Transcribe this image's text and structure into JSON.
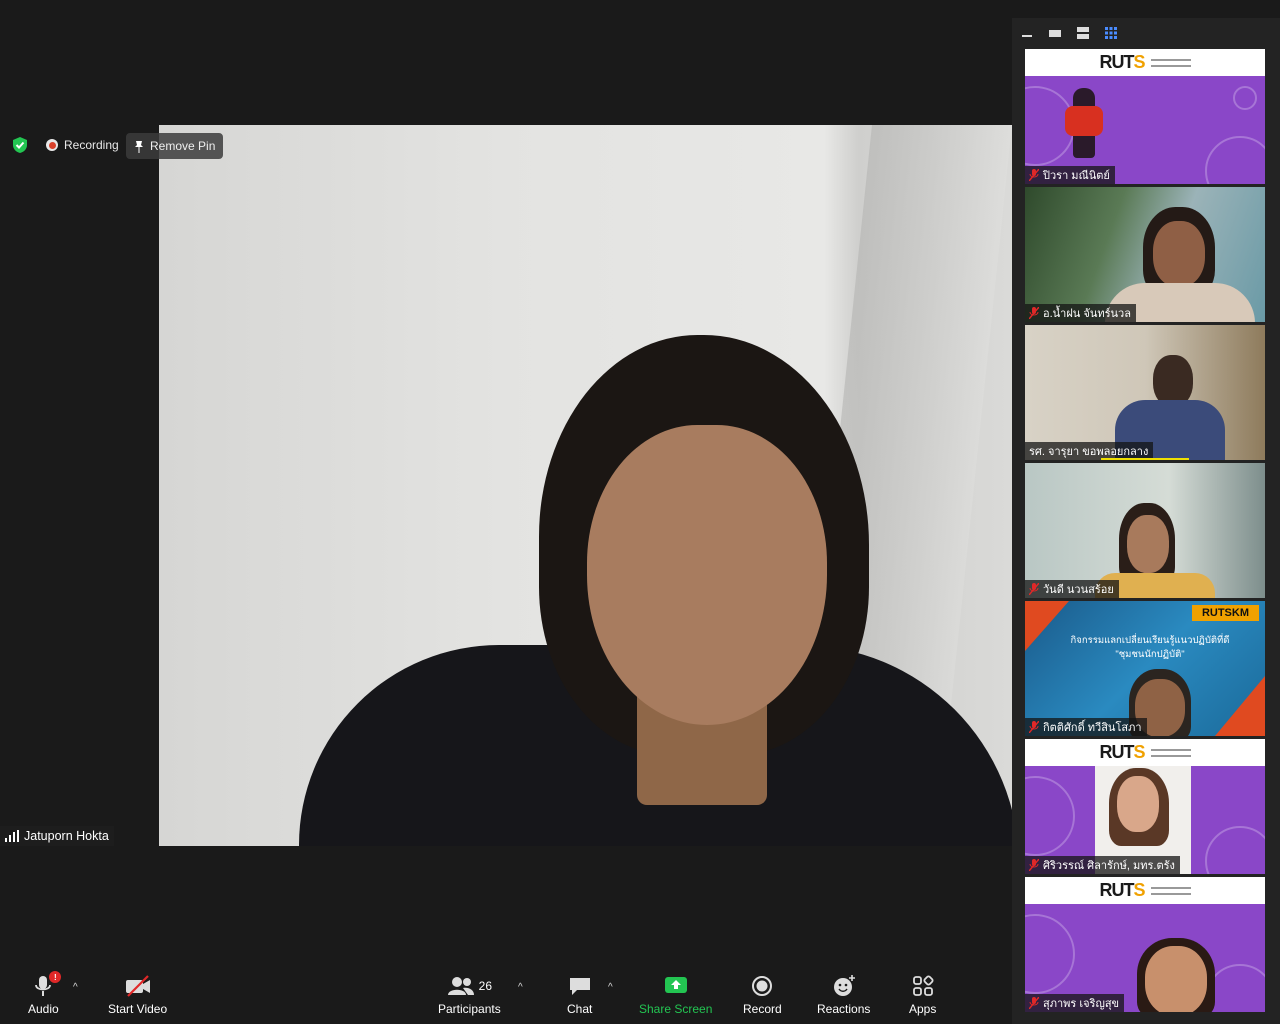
{
  "status": {
    "recording_label": "Recording",
    "remove_pin_label": "Remove Pin"
  },
  "main": {
    "speaker_name": "Jatuporn Hokta"
  },
  "gallery": {
    "tiles": [
      {
        "name": "ปิวรา มณีนิตย์",
        "background": "rut-banner"
      },
      {
        "name": "อ.น้ำฝน จันทร์นวล",
        "background": "video"
      },
      {
        "name": "รศ. จารุยา ขอพลอยกลาง",
        "background": "video"
      },
      {
        "name": "วันดี นวนสร้อย",
        "background": "video"
      },
      {
        "name": "กิตติศักดิ์ ทวีสินโสภา",
        "background": "rutskm-banner"
      },
      {
        "name": "ศิริวรรณ์ ศิลารักษ์, มทร.ตรัง",
        "background": "rut-banner"
      },
      {
        "name": "สุภาพร เจริญสุข",
        "background": "rut-banner"
      }
    ],
    "rut_logo": "RUTS",
    "rutskm_title": "RUTSKM",
    "rutskm_line1": "กิจกรรมแลกเปลี่ยนเรียนรู้แนวปฏิบัติที่ดี",
    "rutskm_line2": "\"ชุมชนนักปฏิบัติ\""
  },
  "toolbar": {
    "audio": "Audio",
    "start_video": "Start Video",
    "participants": "Participants",
    "participants_count": "26",
    "chat": "Chat",
    "share_screen": "Share Screen",
    "record": "Record",
    "reactions": "Reactions",
    "apps": "Apps",
    "audio_badge": "!"
  },
  "colors": {
    "share_green": "#23c552",
    "rut_purple": "#8a47c8",
    "rut_orange": "#f0a100",
    "mute_red": "#e02828"
  }
}
